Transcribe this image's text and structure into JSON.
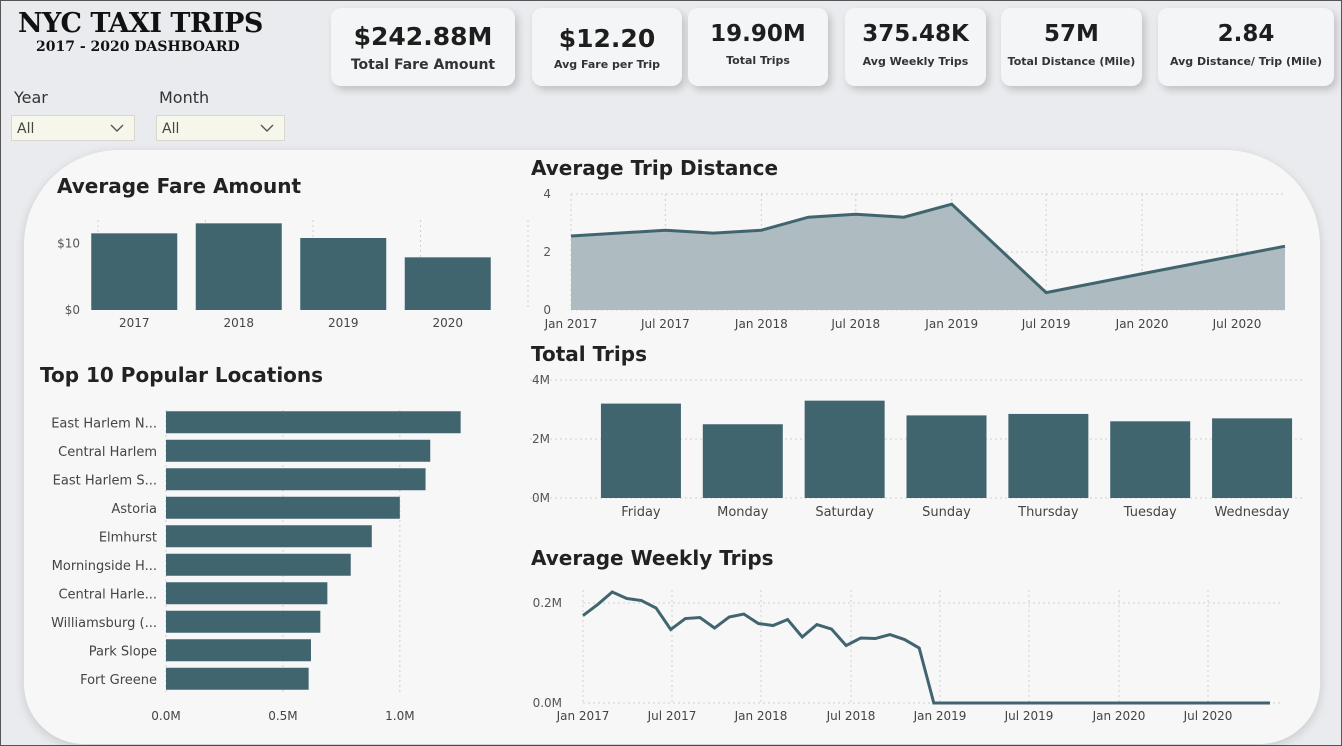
{
  "header": {
    "title": "NYC TAXI TRIPS",
    "subtitle": "2017 - 2020 DASHBOARD"
  },
  "kpis": [
    {
      "value": "$242.88M",
      "label": "Total Fare Amount"
    },
    {
      "value": "$12.20",
      "label": "Avg Fare per Trip"
    },
    {
      "value": "19.90M",
      "label": "Total Trips"
    },
    {
      "value": "375.48K",
      "label": "Avg Weekly Trips"
    },
    {
      "value": "57M",
      "label": "Total Distance (Mile)"
    },
    {
      "value": "2.84",
      "label": "Avg Distance/ Trip (Mile)"
    }
  ],
  "filters": {
    "year": {
      "label": "Year",
      "value": "All"
    },
    "month": {
      "label": "Month",
      "value": "All"
    }
  },
  "colors": {
    "bar": "#41656e",
    "area_fill": "#aebcc1",
    "line": "#41656e",
    "grid": "#cfcfcf"
  },
  "chart_data": [
    {
      "type": "bar",
      "title": "Average Fare Amount",
      "categories": [
        "2017",
        "2018",
        "2019",
        "2020"
      ],
      "values": [
        11.5,
        13.0,
        10.8,
        7.9
      ],
      "ylim": [
        0,
        15
      ],
      "yticks": [
        0,
        10
      ],
      "ytick_labels": [
        "$0",
        "$10"
      ]
    },
    {
      "type": "area",
      "title": "Average Trip Distance",
      "x": [
        "2017-01",
        "2017-07",
        "2017-10",
        "2018-01",
        "2018-04",
        "2018-07",
        "2018-10",
        "2019-01",
        "2019-07",
        "2020-01",
        "2020-10"
      ],
      "values": [
        2.55,
        2.75,
        2.65,
        2.75,
        3.2,
        3.3,
        3.2,
        3.65,
        0.6,
        1.25,
        2.2
      ],
      "ylim": [
        0,
        4
      ],
      "yticks": [
        0,
        2,
        4
      ],
      "xtick_labels": [
        "Jan 2017",
        "Jul 2017",
        "Jan 2018",
        "Jul 2018",
        "Jan 2019",
        "Jul 2019",
        "Jan 2020",
        "Jul 2020"
      ]
    },
    {
      "type": "bar",
      "title": "Total Trips",
      "categories": [
        "Friday",
        "Monday",
        "Saturday",
        "Sunday",
        "Thursday",
        "Tuesday",
        "Wednesday"
      ],
      "values": [
        3200000,
        2500000,
        3300000,
        2800000,
        2850000,
        2600000,
        2700000
      ],
      "ylim": [
        0,
        4000000
      ],
      "yticks": [
        0,
        2000000,
        4000000
      ],
      "ytick_labels": [
        "0M",
        "2M",
        "4M"
      ]
    },
    {
      "type": "bar",
      "orientation": "horizontal",
      "title": "Top 10 Popular Locations",
      "categories": [
        "East Harlem N...",
        "Central Harlem",
        "East Harlem S...",
        "Astoria",
        "Elmhurst",
        "Morningside H...",
        "Central Harle...",
        "Williamsburg (...",
        "Park Slope",
        "Fort Greene"
      ],
      "values": [
        1260000,
        1130000,
        1110000,
        1000000,
        880000,
        790000,
        690000,
        660000,
        620000,
        610000
      ],
      "xlim": [
        0,
        1300000
      ],
      "xticks": [
        0,
        500000,
        1000000
      ],
      "xtick_labels": [
        "0.0M",
        "0.5M",
        "1.0M"
      ]
    },
    {
      "type": "line",
      "title": "Average Weekly Trips",
      "values": [
        0.175,
        0.197,
        0.222,
        0.209,
        0.205,
        0.19,
        0.147,
        0.169,
        0.171,
        0.15,
        0.172,
        0.178,
        0.159,
        0.155,
        0.167,
        0.132,
        0.157,
        0.148,
        0.115,
        0.13,
        0.129,
        0.137,
        0.127,
        0.11,
        0.0,
        0.0,
        0.0,
        0.0,
        0.0,
        0.0,
        0.0,
        0.0,
        0.0,
        0.0,
        0.0,
        0.0,
        0.0,
        0.0,
        0.0,
        0.0,
        0.0,
        0.0,
        0.0,
        0.0,
        0.0,
        0.0,
        0.0,
        0.0
      ],
      "unit_note": "millions of trips, monthly points Jan 2017 - Dec 2020",
      "ylim": [
        0,
        0.3
      ],
      "yticks": [
        0,
        0.2
      ],
      "ytick_labels": [
        "0.0M",
        "0.2M"
      ],
      "xtick_labels": [
        "Jan 2017",
        "Jul 2017",
        "Jan 2018",
        "Jul 2018",
        "Jan 2019",
        "Jul 2019",
        "Jan 2020",
        "Jul 2020"
      ]
    }
  ]
}
